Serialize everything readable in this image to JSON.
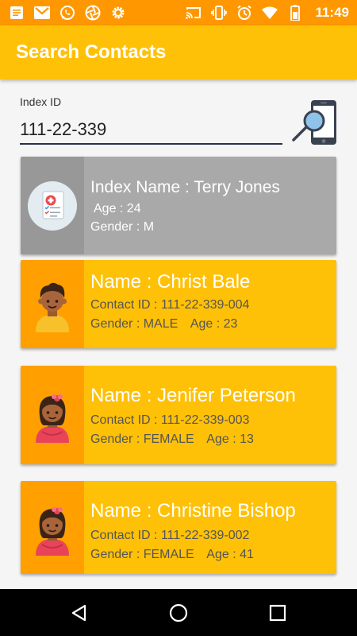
{
  "status_bar": {
    "time": "11:49",
    "left_icons": [
      "notification-icon",
      "gmail-icon",
      "whatsapp-icon",
      "aperture-icon",
      "settings-icon"
    ],
    "right_icons": [
      "cast-icon",
      "vibrate-icon",
      "alarm-icon",
      "wifi-icon",
      "battery-icon"
    ]
  },
  "app_bar": {
    "title": "Search Contacts"
  },
  "search": {
    "label": "Index ID",
    "value": "111-22-339"
  },
  "index_person": {
    "name": "Index Name : Terry Jones",
    "age": "Age : 24",
    "gender": "Gender : M"
  },
  "contacts": [
    {
      "name": "Name : Christ Bale",
      "contact_id": "Contact ID : 111-22-339-004",
      "gender": "Gender : MALE",
      "age": "Age : 23",
      "avatar": "boy-avatar-icon"
    },
    {
      "name": "Name : Jenifer Peterson",
      "contact_id": "Contact ID : 111-22-339-003",
      "gender": "Gender : FEMALE",
      "age": "Age : 13",
      "avatar": "girl-avatar-icon"
    },
    {
      "name": "Name : Christine Bishop",
      "contact_id": "Contact ID : 111-22-339-002",
      "gender": "Gender : FEMALE",
      "age": "Age : 41",
      "avatar": "girl-avatar-icon"
    }
  ],
  "colors": {
    "status_bar": "#FF9800",
    "app_bar": "#FFC107",
    "card": "#FFC107",
    "card_side": "#FFA000",
    "index_card": "#A9A9A9"
  },
  "nav": [
    "back-icon",
    "home-icon",
    "recents-icon"
  ]
}
